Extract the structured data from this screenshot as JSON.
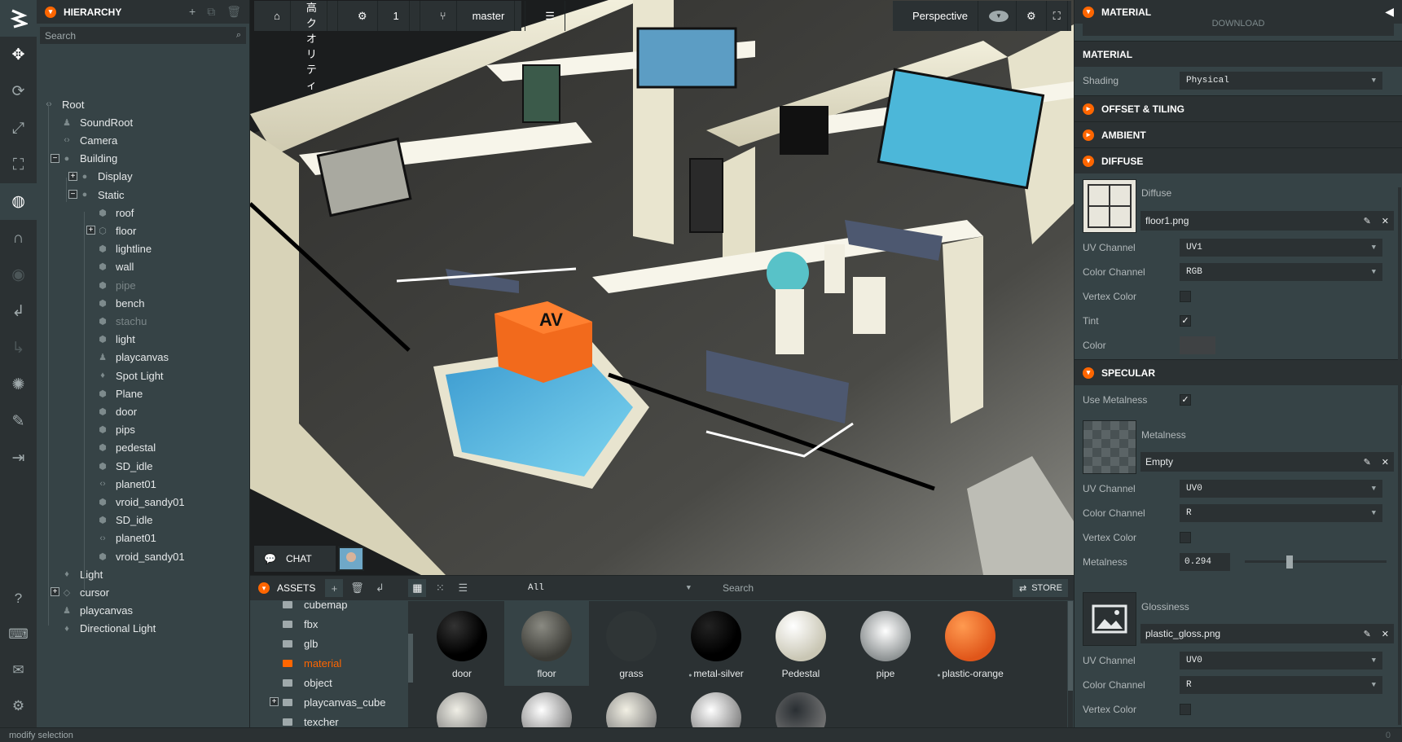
{
  "project": {
    "name": "V美術館 高クオリティ",
    "settings_count": "1",
    "branch": "master"
  },
  "viewport": {
    "camera": "Perspective",
    "chat_label": "CHAT",
    "logo_text": "AV"
  },
  "hierarchy": {
    "title": "HIERARCHY",
    "search_placeholder": "Search",
    "nodes": [
      "Root",
      "SoundRoot",
      "Camera",
      "Building",
      "Display",
      "Static",
      "roof",
      "floor",
      "lightline",
      "wall",
      "pipe",
      "bench",
      "stachu",
      "light",
      "playcanvas",
      "Spot Light",
      "Plane",
      "door",
      "pips",
      "pedestal",
      "SD_idle",
      "planet01",
      "vroid_sandy01",
      "SD_idle",
      "planet01",
      "vroid_sandy01",
      "Light",
      "cursor",
      "playcanvas",
      "Directional Light"
    ]
  },
  "inspector": {
    "title": "MATERIAL",
    "download_label": "DOWNLOAD",
    "section_material": "MATERIAL",
    "shading_label": "Shading",
    "shading_value": "Physical",
    "offset_tiling": "OFFSET & TILING",
    "ambient": "AMBIENT",
    "diffuse": "DIFFUSE",
    "diffuse_label": "Diffuse",
    "diffuse_texture": "floor1.png",
    "uv_channel_label": "UV Channel",
    "diffuse_uv": "UV1",
    "color_channel_label": "Color Channel",
    "diffuse_color_channel": "RGB",
    "vertex_color_label": "Vertex Color",
    "tint_label": "Tint",
    "color_label": "Color",
    "specular": "SPECULAR",
    "use_metalness_label": "Use Metalness",
    "metalness_label": "Metalness",
    "metalness_texture": "Empty",
    "metal_uv": "UV0",
    "metal_color_channel": "R",
    "metalness_value_label": "Metalness",
    "metalness_value": "0.294",
    "metalness_fraction": 0.294,
    "glossiness_label": "Glossiness",
    "gloss_texture": "plastic_gloss.png",
    "gloss_uv": "UV0",
    "gloss_color_channel": "R"
  },
  "assets": {
    "title": "ASSETS",
    "filter": "All",
    "search_placeholder": "Search",
    "store_label": "STORE",
    "folders": [
      "cubemap",
      "fbx",
      "glb",
      "material",
      "object",
      "playcanvas_cube",
      "texcher"
    ],
    "materials": [
      "door",
      "floor",
      "grass",
      "metal-silver",
      "Pedestal",
      "pipe",
      "plastic-orange"
    ]
  },
  "status": {
    "message": "modify selection",
    "count": "0"
  }
}
